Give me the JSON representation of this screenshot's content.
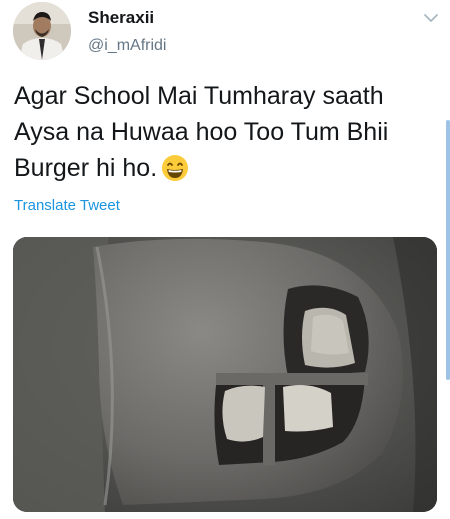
{
  "tweet": {
    "display_name": "Sheraxii",
    "handle": "@i_mAfridi",
    "text_lines": [
      "Agar School Mai Tumharay saath",
      "Aysa na Huwaa hoo Too Tum Bhii",
      "Burger hi ho."
    ],
    "emoji": "grinning-face-with-smiling-eyes",
    "translate_label": "Translate Tweet"
  },
  "icons": {
    "menu": "chevron-down-icon"
  },
  "colors": {
    "text": "#14171a",
    "secondary": "#657786",
    "link": "#1b95e0"
  }
}
